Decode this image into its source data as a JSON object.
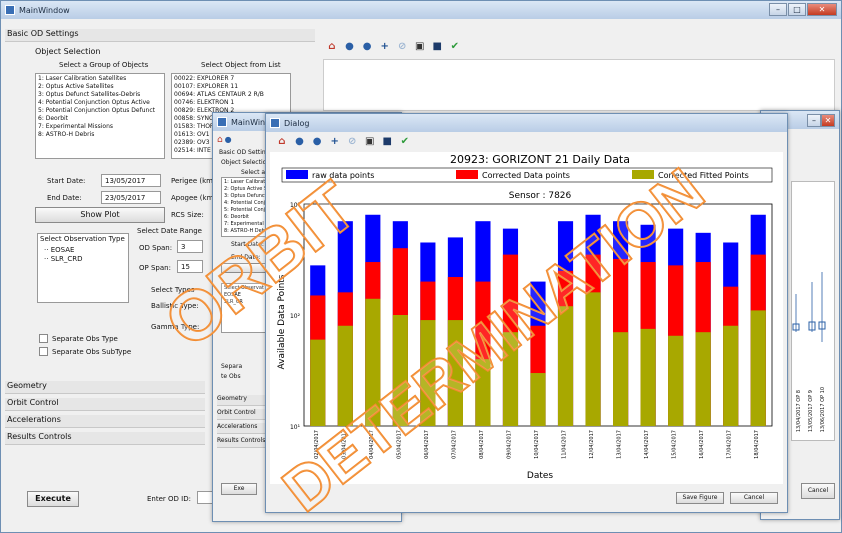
{
  "main_window": {
    "title": "MainWindow",
    "basic_settings": "Basic OD Settings",
    "object_selection": "Object Selection",
    "group_heading": "Select a Group of Objects",
    "list_heading": "Select Object from List",
    "groups": [
      "1: Laser Calibration Satellites",
      "2: Optus Active Satellites",
      "3: Optus Defunct Satellites-Debris",
      "4: Potential Conjunction Optus Active",
      "5: Potential Conjunction Optus Defunct",
      "6: Deorbit",
      "7: Experimental Missions",
      "8: ASTRO-H Debris"
    ],
    "objects": [
      "00022: EXPLORER 7",
      "00107: EXPLORER 11",
      "00694: ATLAS CENTAUR 2 R/B",
      "00746: ELEKTRON 1",
      "00829: ELEKTRON 2",
      "00858: SYNC",
      "01583: THOR",
      "01613: OV1",
      "02389: OV3",
      "02514: INTE"
    ],
    "start_date_label": "Start Date:",
    "start_date": "13/05/2017",
    "end_date_label": "End Date:",
    "end_date": "23/05/2017",
    "perigee_label": "Perigee (km",
    "apogee_label": "Apogee (km",
    "show_plot": "Show Plot",
    "rcs_label": "RCS Size:",
    "obs_type_heading": "Select Observation Type",
    "obs_types": [
      "EOSAE",
      "SLR_CRD"
    ],
    "date_range_heading": "Select Date Range",
    "od_span_label": "OD Span:",
    "od_span": "3",
    "op_span_label": "OP Span:",
    "op_span": "15",
    "select_types": "Select Types",
    "ballistic_label": "Ballistic Type:",
    "gamma_label": "Gamma Type:",
    "sep_obs_type": "Separate Obs Type",
    "sep_obs_subtype": "Separate Obs SubType",
    "geometry": "Geometry",
    "orbit_control": "Orbit Control",
    "accelerations": "Accelerations",
    "results_controls": "Results Controls",
    "execute": "Execute",
    "od_id_label": "Enter OD ID:"
  },
  "middle_window": {
    "title": "MainWindow",
    "basic_settings": "Basic OD Settings",
    "object_selection": "Object Selection",
    "select_group": "Select a G",
    "groups": [
      "1: Laser Calibration",
      "2: Optus Active Sate",
      "3: Optus Defunct Sa",
      "4: Potential Conju",
      "5: Potential Conju",
      "6: Deorbit",
      "7: Experimental Mi",
      "8: ASTRO-H Debris"
    ],
    "start_date_label": "Start Date:",
    "end_date_label": "End Date:",
    "select_observ": "Select Observat",
    "obs_types": [
      "EOSAE",
      "SLR_CR"
    ],
    "separate": "Separa",
    "separate2": "te Obs",
    "geometry": "Geometry",
    "orbit_control": "Orbit Control",
    "accelerations": "Accelerations",
    "results_controls": "Results Controls",
    "execute": "Exe"
  },
  "right_window": {
    "dates": [
      "13/04/2017 OP 8",
      "13/05/2017 OP 9",
      "13/06/2017 OP 10"
    ],
    "cancel": "Cancel"
  },
  "dialog": {
    "title": "Dialog",
    "save_figure": "Save Figure",
    "cancel": "Cancel"
  },
  "overlay": {
    "line1": "ORBIT",
    "line2": "DETERMINATION"
  },
  "chart_data": {
    "type": "bar",
    "title": "20923:  GORIZONT 21 Daily Data",
    "subtitle": "Sensor : 7826",
    "xlabel": "Dates",
    "ylabel": "Available Data Points",
    "yscale": "log",
    "y_tick_labels": [
      "10¹",
      "10²",
      "10³"
    ],
    "legend": [
      "raw data points",
      "Corrected Data points",
      "Corrected Fitted Points"
    ],
    "legend_position": "top",
    "colors": {
      "raw": "#0000ff",
      "corrected": "#ff0000",
      "fitted": "#a8a800"
    },
    "categories": [
      "02/04/2017",
      "03/04/2017",
      "04/04/2017",
      "05/04/2017",
      "06/04/2017",
      "07/04/2017",
      "08/04/2017",
      "09/04/2017",
      "10/04/2017",
      "11/04/2017",
      "12/04/2017",
      "13/04/2017",
      "14/04/2017",
      "15/04/2017",
      "16/04/2017",
      "17/04/2017",
      "18/04/2017"
    ],
    "series": [
      {
        "name": "Corrected Fitted Points",
        "values": [
          60,
          80,
          140,
          100,
          90,
          90,
          40,
          70,
          30,
          120,
          160,
          70,
          75,
          65,
          70,
          80,
          110
        ]
      },
      {
        "name": "Corrected Data points",
        "values": [
          150,
          160,
          300,
          400,
          200,
          220,
          200,
          350,
          80,
          250,
          350,
          320,
          300,
          280,
          300,
          180,
          350
        ]
      },
      {
        "name": "raw data points",
        "values": [
          280,
          700,
          800,
          700,
          450,
          500,
          700,
          600,
          200,
          700,
          800,
          700,
          650,
          600,
          550,
          450,
          800
        ]
      }
    ]
  }
}
